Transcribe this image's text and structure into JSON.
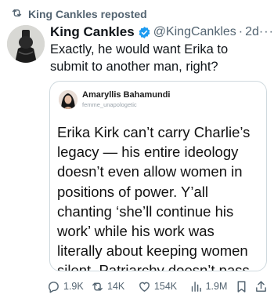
{
  "repost": {
    "label": "King Cankles reposted"
  },
  "post": {
    "author_name": "King Cankles",
    "handle": "@KingCankles",
    "separator": "·",
    "time": "2d",
    "more": "···",
    "text": "Exactly, he would want Erika to submit to another man, right?"
  },
  "quote": {
    "author_name": "Amaryllis Bahamundi",
    "username": "femme_unapologetic",
    "text": "Erika Kirk can’t carry Charlie’s legacy — his entire ideology doesn’t even allow women in positions of power.  Y’all chanting ‘she’ll continue his work’ while his work was literally about keeping women silent. Patriarchy doesn’t pass the mic, sis."
  },
  "actions": {
    "replies": "1.9K",
    "reposts": "14K",
    "likes": "154K",
    "views": "1.9M"
  },
  "colors": {
    "text": "#0f1419",
    "muted": "#536471",
    "verified": "#1d9bf0",
    "border": "#cfd9de"
  },
  "icons": [
    "repost-icon",
    "verified-badge-icon",
    "more-icon",
    "reply-icon",
    "like-icon",
    "views-icon",
    "bookmark-icon",
    "share-icon"
  ]
}
